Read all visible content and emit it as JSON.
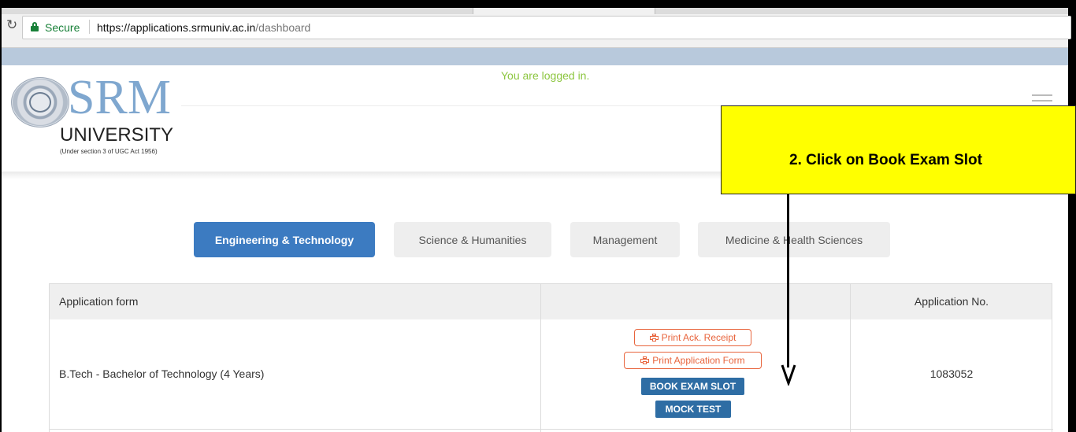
{
  "browser": {
    "reload_icon": "reload-icon",
    "secure_label": "Secure",
    "url_host": "https://applications.srmuniv.ac.in",
    "url_path": "/dashboard"
  },
  "header": {
    "status_message": "You are logged in.",
    "logo_main": "SRM",
    "logo_university": "UNIVERSITY",
    "logo_subtitle": "(Under section 3 of UGC Act 1956)",
    "menu_icon": "hamburger-menu-icon"
  },
  "categories": [
    {
      "label": "Engineering & Technology",
      "active": true
    },
    {
      "label": "Science & Humanities",
      "active": false
    },
    {
      "label": "Management",
      "active": false
    },
    {
      "label": "Medicine & Health Sciences",
      "active": false
    }
  ],
  "table": {
    "headers": [
      "Application form",
      "",
      "Application No."
    ],
    "rows": [
      {
        "course": "B.Tech - Bachelor of Technology (4 Years)",
        "actions": {
          "print_ack": "Print Ack. Receipt",
          "print_form": "Print Application Form",
          "book_slot": "BOOK EXAM SLOT",
          "mock_test": "MOCK TEST"
        },
        "application_no": "1083052"
      }
    ]
  },
  "annotation": {
    "text": "2. Click on Book Exam Slot"
  },
  "colors": {
    "accent_blue": "#3c7bc1",
    "action_orange": "#e8643c",
    "solid_button": "#2e6da4",
    "callout_yellow": "#ffff00",
    "logged_green": "#8cc63f"
  }
}
